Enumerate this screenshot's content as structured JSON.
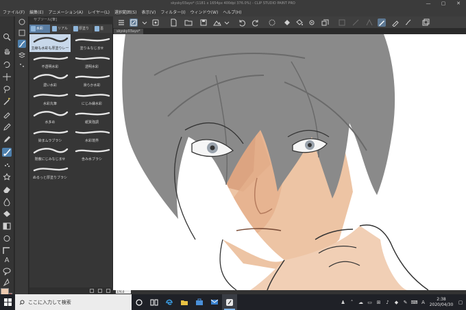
{
  "window": {
    "title": "skysky03ayo* (1181 x 1654px 400dpi 376.0%)  - CLIP STUDIO PAINT PRO",
    "controls": [
      "—",
      "▢",
      "✕"
    ]
  },
  "menu": [
    "ファイル(F)",
    "編集(E)",
    "アニメーション(A)",
    "レイヤー(L)",
    "選択範囲(S)",
    "表示(V)",
    "フィルター(I)",
    "ウィンドウ(W)",
    "ヘルプ(H)"
  ],
  "subtool_panel": {
    "header": "サブツール[筆]",
    "tabs": [
      {
        "label": "水彩",
        "active": true
      },
      {
        "label": "リアル",
        "active": false
      },
      {
        "label": "厚塗り",
        "active": false
      },
      {
        "label": "墨",
        "active": false
      }
    ],
    "brushes": [
      {
        "label": "主線も水彩も厚塗りレー",
        "selected": true
      },
      {
        "label": "塗り＆なじませ",
        "selected": false
      },
      {
        "label": "不透明水彩",
        "selected": false
      },
      {
        "label": "透明水彩",
        "selected": false
      },
      {
        "label": "濃い水彩",
        "selected": false
      },
      {
        "label": "滑らか水彩",
        "selected": false
      },
      {
        "label": "水彩丸筆",
        "selected": false
      },
      {
        "label": "にじみ縁水彩",
        "selected": false
      },
      {
        "label": "水多め",
        "selected": false
      },
      {
        "label": "紙質強調",
        "selected": false
      },
      {
        "label": "染まムラブラシ",
        "selected": false
      },
      {
        "label": "水彩境界",
        "selected": false
      },
      {
        "label": "隠蔽にじみなじませ",
        "selected": false
      },
      {
        "label": "含み水ブラシ",
        "selected": false
      },
      {
        "label": "ぬるっと厚塗りブラシ",
        "selected": false
      }
    ]
  },
  "document_tab": "skysky03ayo*",
  "statusbar": {
    "zoom": "376.0"
  },
  "taskbar": {
    "search_placeholder": "ここに入力して検索",
    "clock_time": "2:38",
    "clock_date": "2020/04/30",
    "ime": "A"
  },
  "colors": {
    "accent": "#4e80ad",
    "main_color": "#eccab0",
    "sub_color": "#b6504a",
    "canvas_bg": "#ffffff",
    "taskbar": "#1f2127"
  },
  "icons": {
    "tools": [
      "zoom-icon",
      "move-icon",
      "rotate-icon",
      "select-icon",
      "lasso-icon",
      "wand-icon",
      "eyedropper-icon",
      "pen-icon",
      "pencil-icon",
      "brush-icon",
      "airbrush-icon",
      "decoration-icon",
      "eraser-icon",
      "blend-icon",
      "fill-icon",
      "gradient-icon",
      "shape-icon",
      "frame-icon",
      "ruler-icon",
      "text-icon",
      "balloon-icon",
      "correct-line-icon"
    ],
    "toolbar": [
      "menu-icon",
      "command-bar-icon",
      "new-icon",
      "open-icon",
      "save-icon",
      "undo-icon",
      "redo-icon",
      "clear-icon",
      "fill-icon",
      "settings-icon",
      "transform-icon"
    ]
  }
}
